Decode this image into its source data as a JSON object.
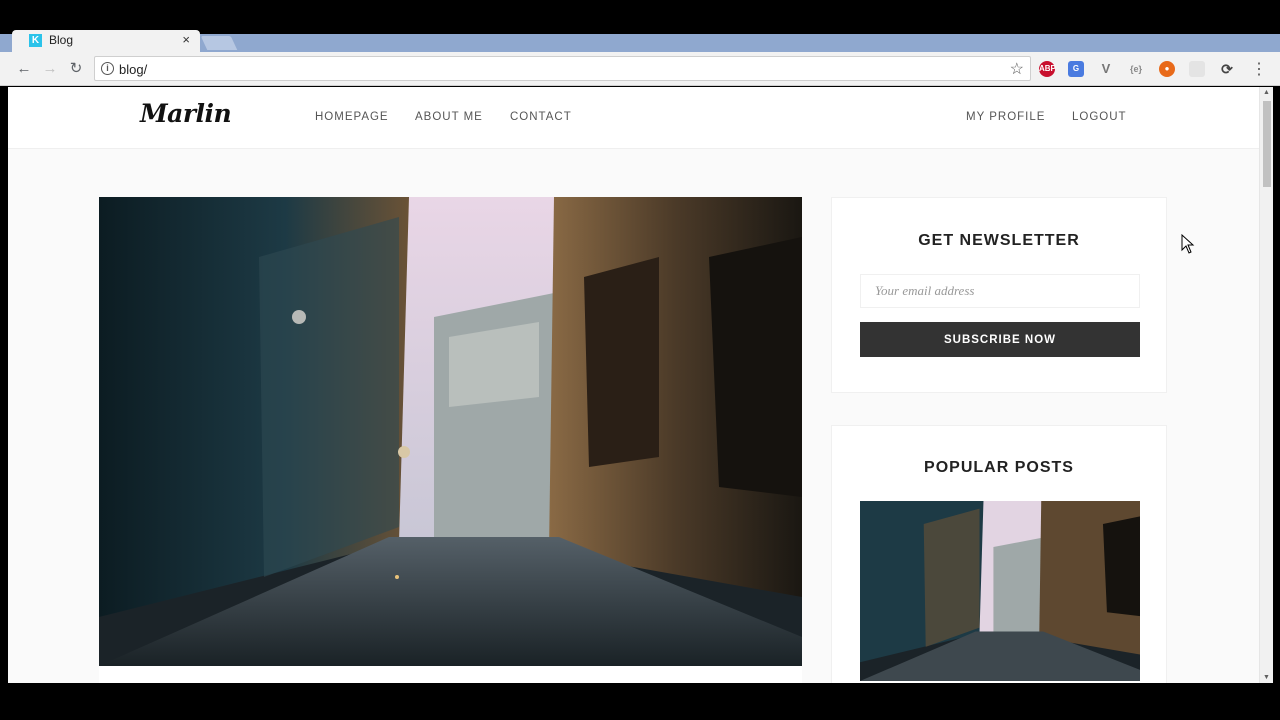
{
  "browser": {
    "tab_title": "Blog",
    "tab_favicon": "K",
    "tab_close": "×",
    "url": "blog/",
    "extensions": [
      "adblock-icon",
      "translate-icon",
      "vimium-icon",
      "json-icon",
      "paw-icon",
      "cloud-icon",
      "sync-icon"
    ]
  },
  "site": {
    "logo": "Marlin",
    "nav": [
      "HOMEPAGE",
      "ABOUT ME",
      "CONTACT"
    ],
    "user_nav": [
      "MY PROFILE",
      "LOGOUT"
    ]
  },
  "newsletter": {
    "title": "GET NEWSLETTER",
    "email_placeholder": "Your email address",
    "button": "SUBSCRIBE NOW"
  },
  "popular_posts": {
    "title": "POPULAR POSTS"
  },
  "colors": {
    "button_bg": "#333333",
    "page_bg": "#fafafa",
    "favicon": "#2bc3ea"
  }
}
